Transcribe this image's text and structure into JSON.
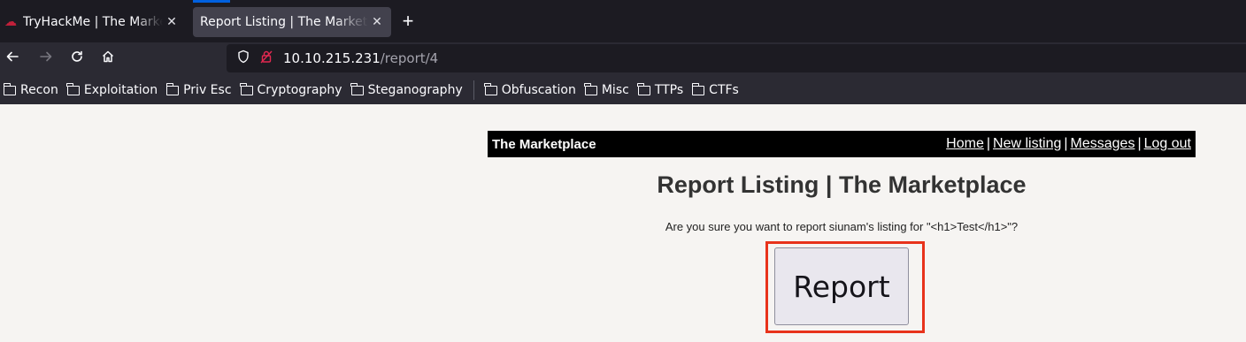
{
  "browser": {
    "tabs": [
      {
        "title": "TryHackMe | The Marketplace",
        "active": false
      },
      {
        "title": "Report Listing | The Marketplace",
        "active": true
      }
    ],
    "new_tab_label": "+",
    "url": {
      "host": "10.10.215.231",
      "path": "/report/4"
    },
    "bookmarks": [
      "Recon",
      "Exploitation",
      "Priv Esc",
      "Cryptography",
      "Steganography",
      "Obfuscation",
      "Misc",
      "TTPs",
      "CTFs"
    ],
    "icons": {
      "back": "arrow-left-icon",
      "forward": "arrow-right-icon",
      "reload": "reload-icon",
      "home": "home-icon",
      "shield": "shield-icon",
      "lock": "insecure-lock-icon",
      "folder": "folder-icon",
      "close": "close-icon"
    }
  },
  "site": {
    "brand": "The Marketplace",
    "nav": [
      "Home",
      "New listing",
      "Messages",
      "Log out"
    ],
    "separator": "|"
  },
  "main": {
    "title": "Report Listing | The Marketplace",
    "confirm_text": "Are you sure you want to report siunam's listing for \"<h1>Test</h1>\"?",
    "report_button": "Report"
  },
  "colors": {
    "highlight": "#e8321b",
    "header_bg": "#000000",
    "page_bg": "#f6f4f2"
  }
}
